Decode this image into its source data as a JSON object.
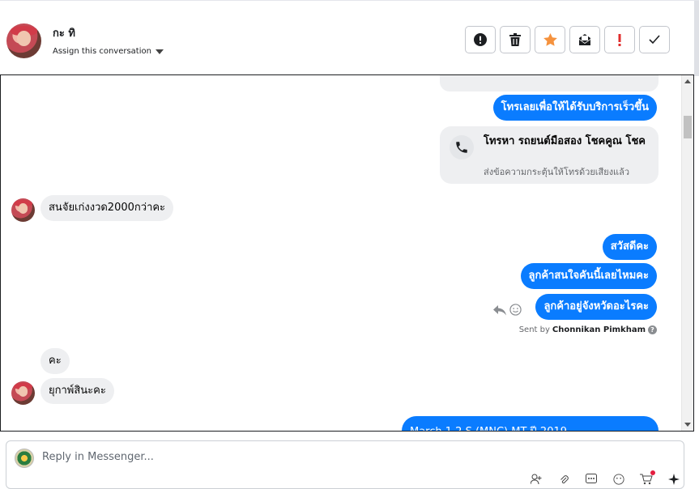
{
  "header": {
    "contact_name": "กะ ทิ",
    "assign_label": "Assign this conversation"
  },
  "toolbar": [
    {
      "name": "mark-spam-button",
      "icon": "alert-circle-icon"
    },
    {
      "name": "delete-button",
      "icon": "trash-icon"
    },
    {
      "name": "star-button",
      "icon": "star-icon",
      "color": "#f5923e"
    },
    {
      "name": "mark-unread-button",
      "icon": "envelope-icon"
    },
    {
      "name": "follow-up-button",
      "icon": "exclamation-icon",
      "color": "#e02d2d"
    },
    {
      "name": "mark-done-button",
      "icon": "check-icon"
    }
  ],
  "messages": {
    "out_1": "โทรเลยเพื่อให้ได้รับบริการเร็วขึ้น",
    "call_card": {
      "title": "โทรหา รถยนต์มือสอง โชคคูณ โชค",
      "subtitle": "ส่งข้อความกระตุ้นให้โทรด้วยเสียงแล้ว"
    },
    "in_1": "สนจัยเก่งงวด2000กว่าคะ",
    "out_2": "สวัสดีคะ",
    "out_3": "ลูกค้าสนใจคันนี้เลยไหมคะ",
    "out_4": "ลูกค้าอยู่จังหวัดอะไรคะ",
    "sent_by_prefix": "Sent by",
    "sent_by_name": "Chonnikan Pimkham",
    "in_2": "คะ",
    "in_3": "ยุกาพ์สินะคะ",
    "out_5_partial": "March 1.2 S (MNC) MT ปี 2019"
  },
  "composer": {
    "placeholder": "Reply in Messenger..."
  },
  "colors": {
    "outgoing_bubble": "#0a7cff",
    "incoming_bubble": "#eeeff1"
  }
}
